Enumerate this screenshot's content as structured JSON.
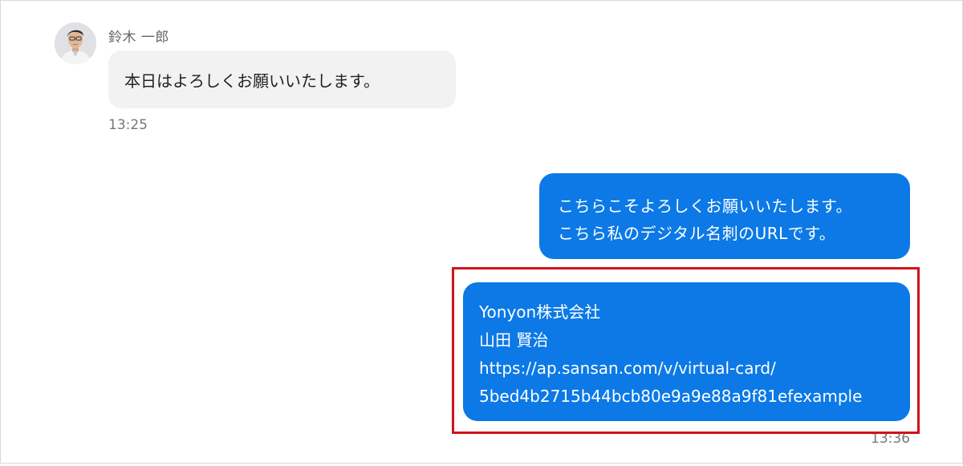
{
  "chat": {
    "incoming": {
      "sender_name": "鈴木 一郎",
      "avatar_icon": "user-avatar-icon",
      "message": "本日はよろしくお願いいたします。",
      "time": "13:25"
    },
    "outgoing": {
      "message_lines": [
        "こちらこそよろしくお願いいたします。",
        "こちら私のデジタル名刺のURLです。"
      ],
      "card_lines": [
        "Yonyon株式会社",
        "山田 賢治",
        "https://ap.sansan.com/v/virtual-card/",
        "5bed4b2715b44bcb80e9a9e88a9f81efexample"
      ],
      "time": "13:36"
    }
  },
  "colors": {
    "outgoing_bubble": "#0c79e6",
    "incoming_bubble": "#f2f2f2",
    "highlight_border": "#d0121b"
  }
}
